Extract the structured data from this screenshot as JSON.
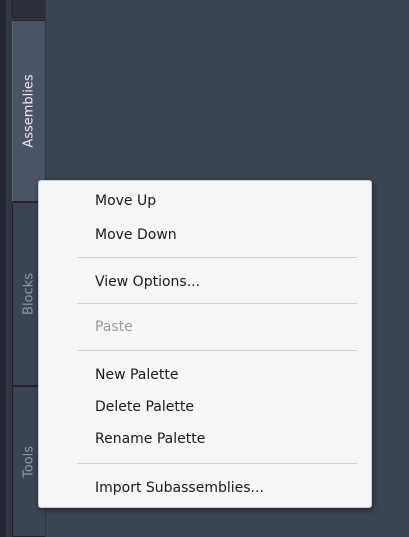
{
  "palette_tabs": [
    {
      "label": "Assemblies",
      "state": "active"
    },
    {
      "label": "Blocks",
      "state": "inactive"
    },
    {
      "label": "Tools",
      "state": "inactive"
    }
  ],
  "context_menu": {
    "items": [
      {
        "label": "Move Up",
        "enabled": true
      },
      {
        "label": "Move Down",
        "enabled": true
      },
      {
        "label": "View Options...",
        "enabled": true
      },
      {
        "label": "Paste",
        "enabled": false
      },
      {
        "label": "New Palette",
        "enabled": true
      },
      {
        "label": "Delete Palette",
        "enabled": true
      },
      {
        "label": "Rename Palette",
        "enabled": true
      },
      {
        "label": "Import Subassemblies...",
        "enabled": true
      }
    ]
  },
  "colors": {
    "background": "#3b4453",
    "menu_background": "#f5f6f7",
    "menu_text": "#1a1a1a",
    "menu_text_disabled": "#9a9a9a"
  }
}
